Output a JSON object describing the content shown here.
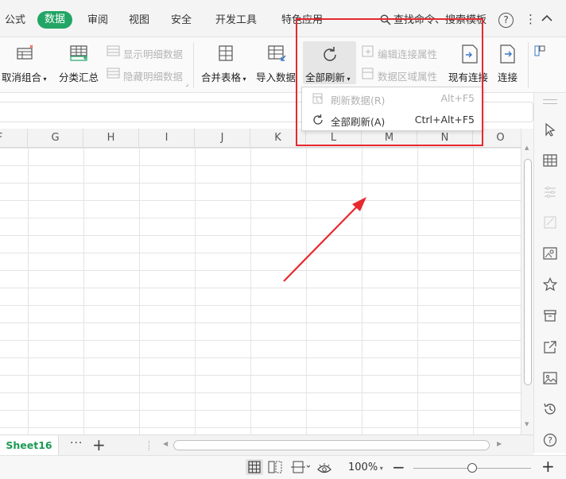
{
  "menu": {
    "tabs": [
      {
        "label": "公式"
      },
      {
        "label": "数据",
        "active": true
      },
      {
        "label": "审阅"
      },
      {
        "label": "视图"
      },
      {
        "label": "安全"
      },
      {
        "label": "开发工具"
      },
      {
        "label": "特色应用"
      }
    ],
    "search_label": "查找命令、搜索模板",
    "help_label": "?",
    "more_label": "⋮"
  },
  "ribbon": {
    "ungroup": "取消组合",
    "subtotal": "分类汇总",
    "show_detail": "显示明细数据",
    "hide_detail": "隐藏明细数据",
    "merge_tables": "合并表格",
    "import_data": "导入数据",
    "refresh_all": "全部刷新",
    "edit_connection": "编辑连接属性",
    "range_properties": "数据区域属性",
    "existing_connections": "现有连接",
    "connections": "连接"
  },
  "dropdown": {
    "items": [
      {
        "label": "刷新数据(R)",
        "shortcut": "Alt+F5",
        "enabled": false
      },
      {
        "label": "全部刷新(A)",
        "shortcut": "Ctrl+Alt+F5",
        "enabled": true
      }
    ]
  },
  "grid": {
    "columns": [
      "F",
      "G",
      "H",
      "I",
      "J",
      "K",
      "L",
      "M",
      "N",
      "O"
    ]
  },
  "sheets": {
    "active_tab": "Sheet16",
    "more_label": "···",
    "add_label": "+"
  },
  "status": {
    "zoom": "100%",
    "zoom_minus": "−",
    "zoom_plus": "+"
  },
  "colors": {
    "accent_green": "#22a565",
    "annotation_red": "#e8282d"
  },
  "annotation": {
    "type": "red-arrow-and-box",
    "target": "refresh-all-menu"
  }
}
